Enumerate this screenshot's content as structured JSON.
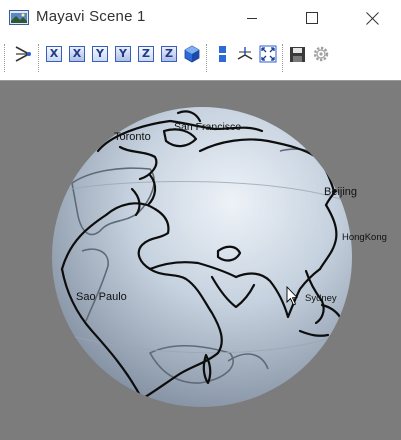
{
  "window": {
    "title": "Mayavi Scene 1"
  },
  "toolbar": {
    "axis_buttons": [
      "X",
      "X",
      "Y",
      "Y",
      "Z",
      "Z"
    ]
  },
  "scene": {
    "background_color": "#7c7c7c",
    "globe_color": "#c6d2df",
    "outline_color": "#000000",
    "cities": [
      "San Francisco",
      "Toronto",
      "Beijing",
      "HongKong",
      "Sao Paulo",
      "Sydney"
    ]
  },
  "icons": [
    "mayavi-app-icon",
    "minimize-icon",
    "maximize-icon",
    "close-icon",
    "pipeline-icon",
    "view-x-plus-icon",
    "view-x-minus-icon",
    "view-y-plus-icon",
    "view-y-minus-icon",
    "view-z-plus-icon",
    "view-z-minus-icon",
    "isometric-view-icon",
    "parallel-projection-icon",
    "axes-indicator-icon",
    "fullscreen-icon",
    "save-icon",
    "settings-gear-icon",
    "mouse-cursor-icon"
  ]
}
